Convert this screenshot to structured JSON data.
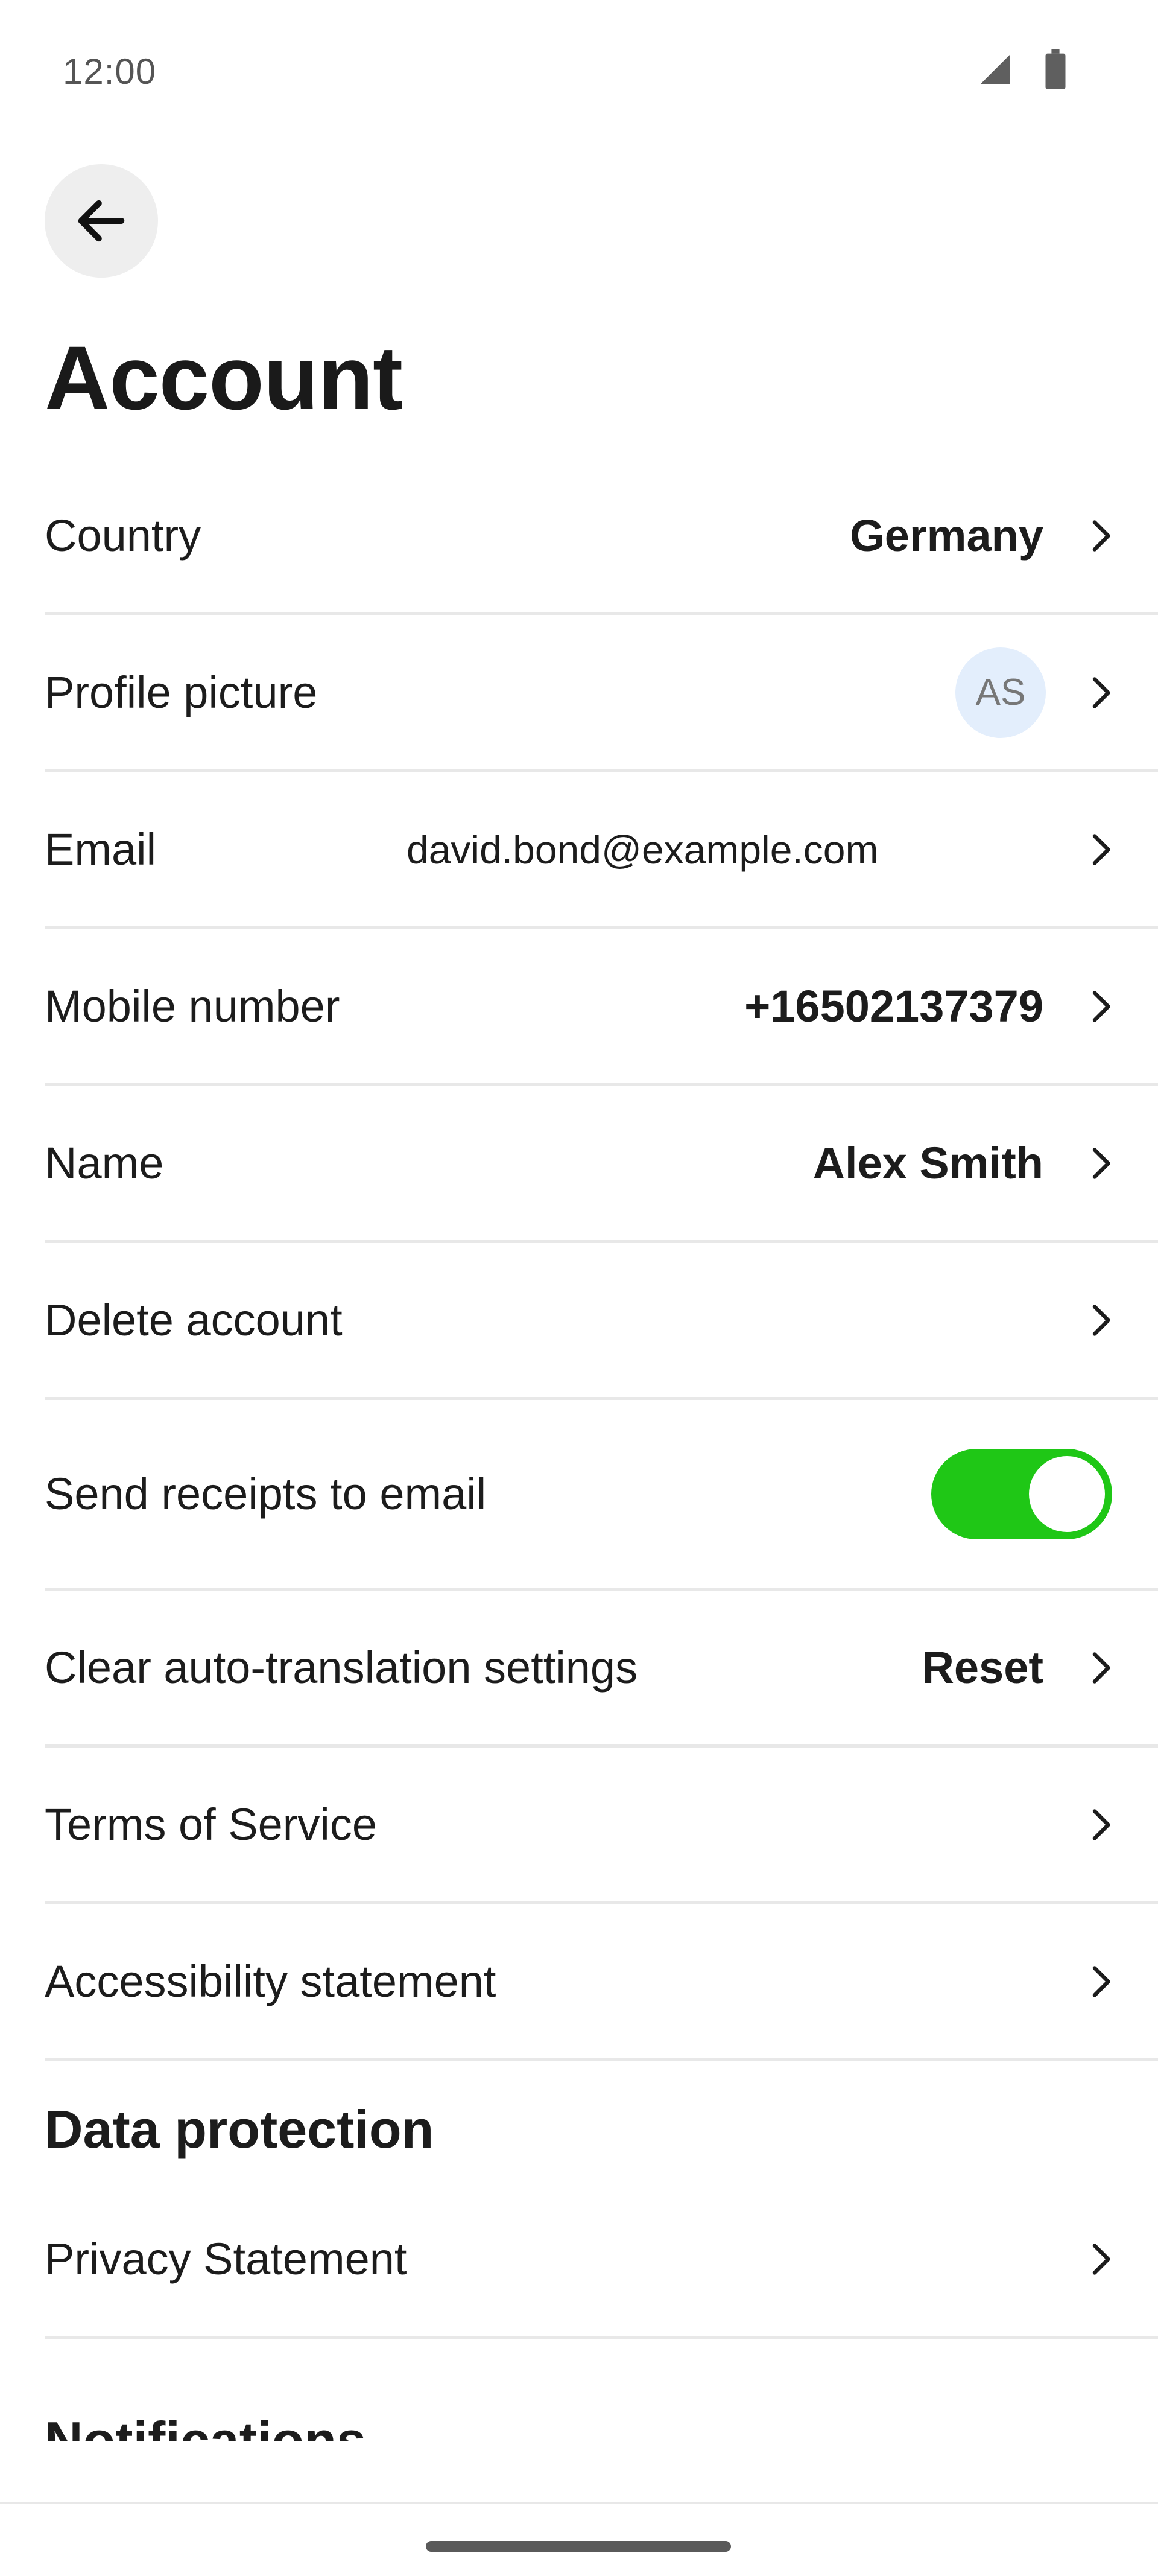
{
  "status_bar": {
    "time": "12:00",
    "icons": [
      "signal-icon",
      "battery-icon"
    ]
  },
  "header": {
    "back_icon": "arrow-left-icon",
    "title": "Account"
  },
  "rows": [
    {
      "id": "country",
      "label": "Country",
      "value": "Germany"
    },
    {
      "id": "profile-picture",
      "label": "Profile picture",
      "avatar_initials": "AS"
    },
    {
      "id": "email",
      "label": "Email",
      "value": "david.bond@example.com"
    },
    {
      "id": "mobile-number",
      "label": "Mobile number",
      "value": "+16502137379"
    },
    {
      "id": "name",
      "label": "Name",
      "value": "Alex Smith"
    },
    {
      "id": "delete-account",
      "label": "Delete account"
    },
    {
      "id": "send-receipts",
      "label": "Send receipts to email",
      "toggle_on": true
    },
    {
      "id": "clear-translation",
      "label": "Clear auto-translation settings",
      "value": "Reset"
    },
    {
      "id": "terms",
      "label": "Terms of Service"
    },
    {
      "id": "accessibility",
      "label": "Accessibility statement"
    }
  ],
  "sections": {
    "data_protection": {
      "title": "Data protection",
      "rows": [
        {
          "id": "privacy-statement",
          "label": "Privacy Statement"
        }
      ]
    },
    "notifications": {
      "title": "Notifications"
    }
  },
  "colors": {
    "toggle_on": "#1fc716",
    "avatar_bg": "#e3eefc",
    "divider": "#e8e8e8",
    "back_button_bg": "#eeeeee"
  }
}
